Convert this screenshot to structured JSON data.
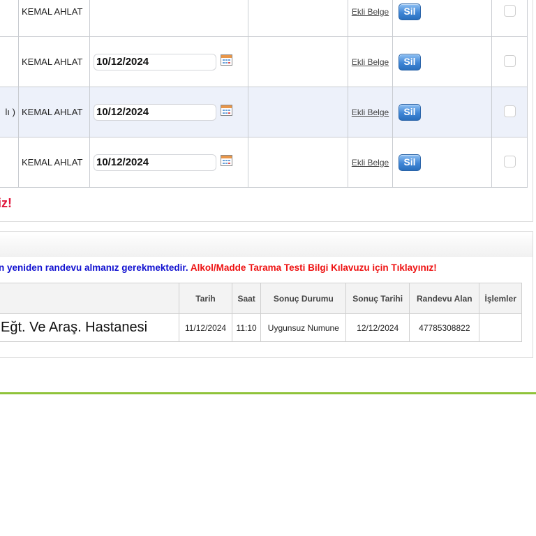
{
  "documents": {
    "rows": [
      {
        "left_fragment": "",
        "name": "KEMAL AHLAT",
        "date": "",
        "link": "Ekli Belge",
        "delete_label": "Sil"
      },
      {
        "left_fragment": "",
        "name": "KEMAL AHLAT",
        "date": "10/12/2024",
        "link": "Ekli Belge",
        "delete_label": "Sil"
      },
      {
        "left_fragment": "lı )",
        "name": "KEMAL AHLAT",
        "date": "10/12/2024",
        "link": "Ekli Belge",
        "delete_label": "Sil"
      },
      {
        "left_fragment": "",
        "name": "KEMAL AHLAT",
        "date": "10/12/2024",
        "link": "Ekli Belge",
        "delete_label": "Sil"
      }
    ],
    "warning": "iz!"
  },
  "appointments": {
    "notice_blue": "n yeniden randevu almanız gerekmektedir.",
    "notice_red": "Alkol/Madde Tarama Testi Bilgi Kılavuzu için Tıklayınız!",
    "headers": [
      "",
      "Tarih",
      "Saat",
      "Sonuç Durumu",
      "Sonuç Tarihi",
      "Randevu Alan",
      "İşlemler"
    ],
    "rows": [
      {
        "hospital": "Eğt. Ve Araş. Hastanesi",
        "date": "11/12/2024",
        "time": "11:10",
        "status": "Uygunsuz Numune",
        "result_date": "12/12/2024",
        "taken_by": "47785308822",
        "actions": ""
      }
    ]
  },
  "colors": {
    "accent_line": "#8fc33a",
    "warning_red": "#e0153b",
    "notice_blue": "#1010d0",
    "button_blue": "#3f86d6"
  },
  "icons": {
    "calendar": "calendar-icon"
  }
}
